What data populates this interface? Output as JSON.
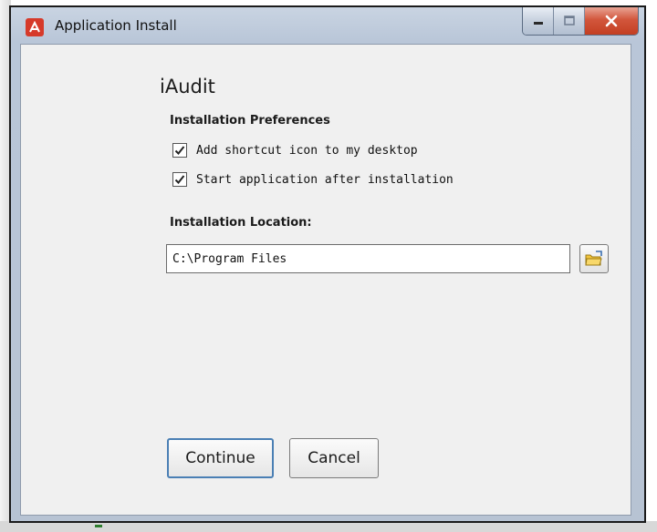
{
  "window": {
    "title": "Application Install"
  },
  "caption": {
    "minimize": "minimize",
    "maximize": "maximize",
    "close": "close"
  },
  "app": {
    "name": "iAudit"
  },
  "preferences": {
    "heading": "Installation Preferences",
    "options": [
      {
        "label": "Add shortcut icon to my desktop",
        "checked": true
      },
      {
        "label": "Start application after installation",
        "checked": true
      }
    ]
  },
  "location": {
    "heading": "Installation Location:",
    "value": "C:\\Program Files"
  },
  "buttons": {
    "continue": "Continue",
    "cancel": "Cancel"
  },
  "colors": {
    "accent_border": "#4a7fb4",
    "close_button": "#c33f22",
    "app_icon": "#d63a2a"
  }
}
